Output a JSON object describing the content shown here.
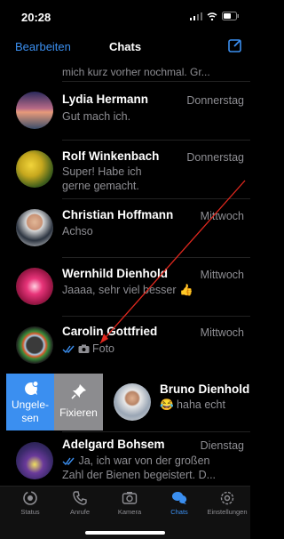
{
  "status": {
    "time": "20:28"
  },
  "nav": {
    "edit_label": "Bearbeiten",
    "title": "Chats"
  },
  "chats": {
    "partial_text": "mich kurz vorher nochmal. Gr...",
    "items": [
      {
        "name": "Lydia Hermann",
        "date": "Donnerstag",
        "message": "Gut mach ich."
      },
      {
        "name": "Rolf Winkenbach",
        "date": "Donnerstag",
        "message": "Super! Habe ich gerne gemacht."
      },
      {
        "name": "Christian Hoffmann",
        "date": "Mittwoch",
        "message": "Achso"
      },
      {
        "name": "Wernhild Dienhold",
        "date": "Mittwoch",
        "message": "Jaaaa, sehr viel besser 👍"
      },
      {
        "name": "Carolin Gottfried",
        "date": "Mittwoch",
        "message": "Foto"
      },
      {
        "name": "Adelgard Bohsem",
        "date": "Dienstag",
        "message": "Ja, ich war von der großen Zahl der Bienen begeistert. D..."
      }
    ],
    "swiped": {
      "name": "Bruno Dienhold",
      "message": "😂 haha echt"
    }
  },
  "swipe_actions": {
    "unread_label": "Ungele-sen",
    "pin_label": "Fixieren"
  },
  "tabs": [
    {
      "label": "Status",
      "icon": "status-icon"
    },
    {
      "label": "Anrufe",
      "icon": "phone-icon"
    },
    {
      "label": "Kamera",
      "icon": "camera-icon"
    },
    {
      "label": "Chats",
      "icon": "chats-icon"
    },
    {
      "label": "Einstellungen",
      "icon": "settings-icon"
    }
  ],
  "colors": {
    "accent": "#3b8ff0",
    "pin": "#8c8c8f",
    "annotation": "#e0281e"
  }
}
